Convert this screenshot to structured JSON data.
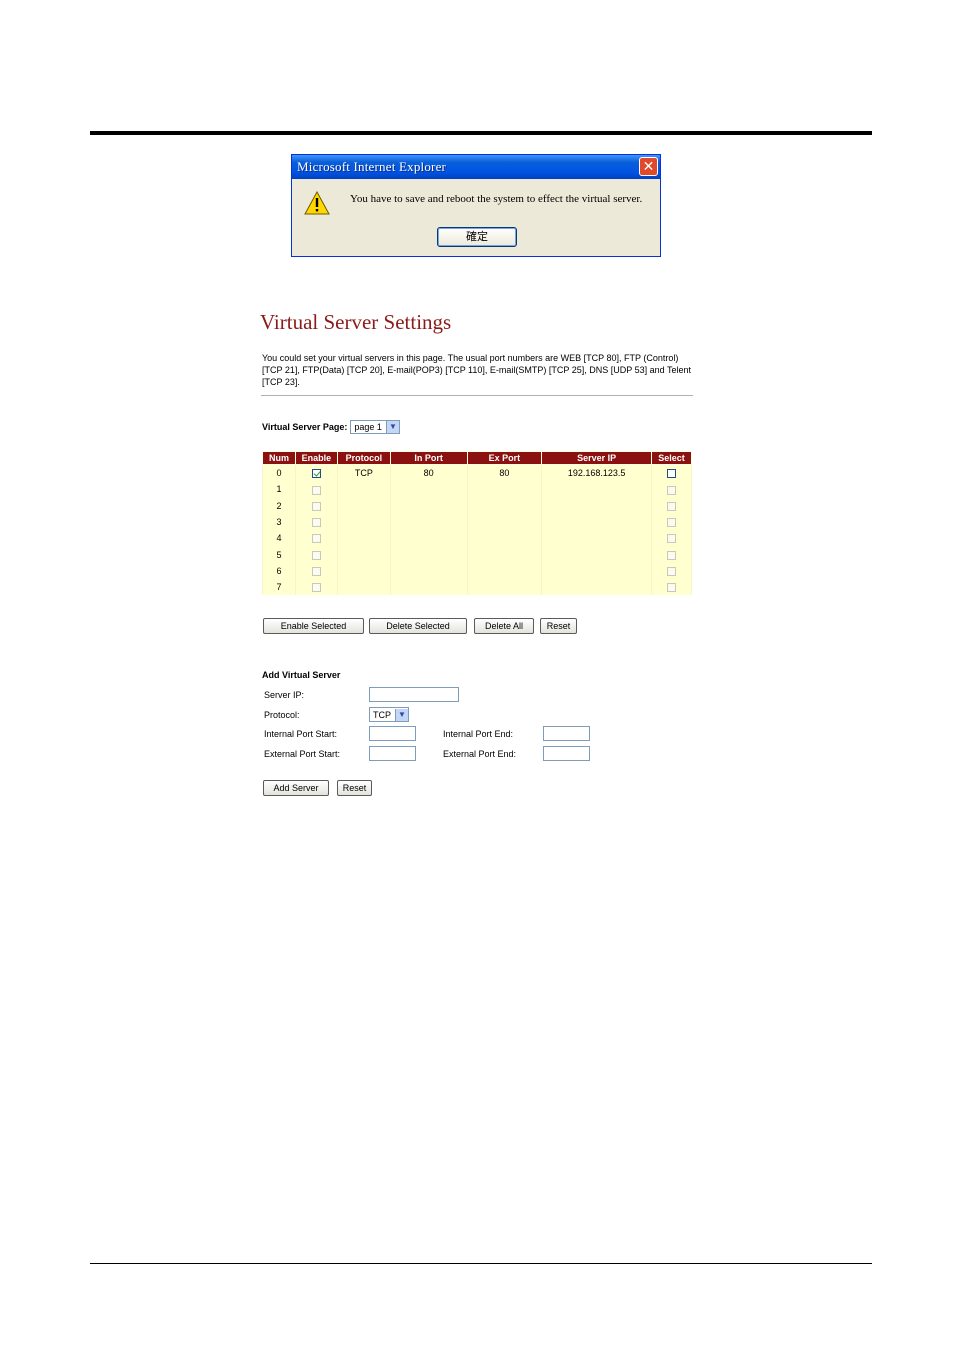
{
  "dialog": {
    "title": "Microsoft Internet Explorer",
    "close": "✕",
    "message": "You have to save and reboot the system to effect the virtual server.",
    "ok_label": "確定"
  },
  "page": {
    "title": "Virtual Server Settings",
    "description": "You could set your virtual servers in this page. The usual port numbers are WEB [TCP 80], FTP (Control) [TCP 21], FTP(Data) [TCP 20], E-mail(POP3) [TCP 110], E-mail(SMTP) [TCP 25], DNS [UDP 53] and Telent [TCP 23].",
    "vs_page_label": "Virtual Server Page:",
    "vs_page_value": "page 1"
  },
  "table": {
    "headers": [
      "Num",
      "Enable",
      "Protocol",
      "In Port",
      "Ex Port",
      "Server IP",
      "Select"
    ],
    "rows": [
      {
        "num": "0",
        "enabled": true,
        "protocol": "TCP",
        "in_port": "80",
        "ex_port": "80",
        "server_ip": "192.168.123.5"
      },
      {
        "num": "1",
        "enabled": false,
        "protocol": "",
        "in_port": "",
        "ex_port": "",
        "server_ip": ""
      },
      {
        "num": "2",
        "enabled": false,
        "protocol": "",
        "in_port": "",
        "ex_port": "",
        "server_ip": ""
      },
      {
        "num": "3",
        "enabled": false,
        "protocol": "",
        "in_port": "",
        "ex_port": "",
        "server_ip": ""
      },
      {
        "num": "4",
        "enabled": false,
        "protocol": "",
        "in_port": "",
        "ex_port": "",
        "server_ip": ""
      },
      {
        "num": "5",
        "enabled": false,
        "protocol": "",
        "in_port": "",
        "ex_port": "",
        "server_ip": ""
      },
      {
        "num": "6",
        "enabled": false,
        "protocol": "",
        "in_port": "",
        "ex_port": "",
        "server_ip": ""
      },
      {
        "num": "7",
        "enabled": false,
        "protocol": "",
        "in_port": "",
        "ex_port": "",
        "server_ip": ""
      }
    ]
  },
  "buttons": {
    "enable_selected": "Enable Selected",
    "delete_selected": "Delete Selected",
    "delete_all": "Delete All",
    "reset": "Reset"
  },
  "add_server": {
    "title": "Add Virtual Server",
    "server_ip_label": "Server IP:",
    "protocol_label": "Protocol:",
    "protocol_value": "TCP",
    "internal_start_label": "Internal Port Start:",
    "internal_end_label": "Internal Port End:",
    "external_start_label": "External Port Start:",
    "external_end_label": "External Port End:",
    "add_button": "Add Server",
    "reset_button": "Reset"
  }
}
